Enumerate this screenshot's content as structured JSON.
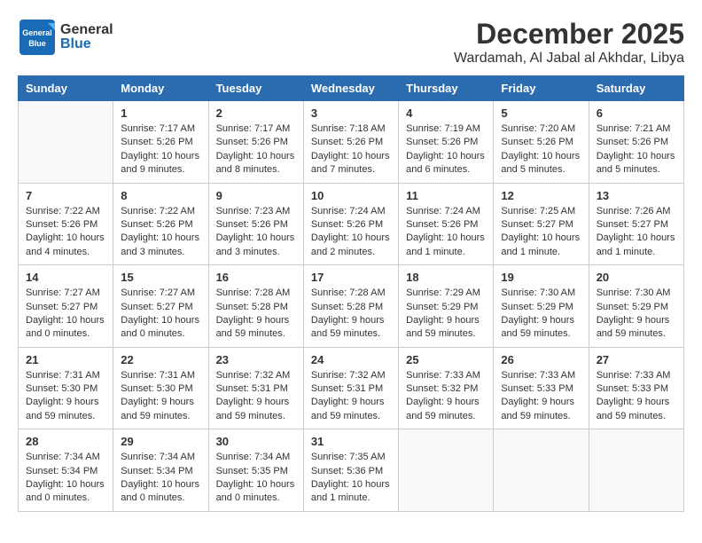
{
  "logo": {
    "general": "General",
    "blue": "Blue"
  },
  "title": "December 2025",
  "location": "Wardamah, Al Jabal al Akhdar, Libya",
  "days_of_week": [
    "Sunday",
    "Monday",
    "Tuesday",
    "Wednesday",
    "Thursday",
    "Friday",
    "Saturday"
  ],
  "weeks": [
    [
      {
        "day": "",
        "sunrise": "",
        "sunset": "",
        "daylight": "",
        "empty": true
      },
      {
        "day": "1",
        "sunrise": "Sunrise: 7:17 AM",
        "sunset": "Sunset: 5:26 PM",
        "daylight": "Daylight: 10 hours and 9 minutes."
      },
      {
        "day": "2",
        "sunrise": "Sunrise: 7:17 AM",
        "sunset": "Sunset: 5:26 PM",
        "daylight": "Daylight: 10 hours and 8 minutes."
      },
      {
        "day": "3",
        "sunrise": "Sunrise: 7:18 AM",
        "sunset": "Sunset: 5:26 PM",
        "daylight": "Daylight: 10 hours and 7 minutes."
      },
      {
        "day": "4",
        "sunrise": "Sunrise: 7:19 AM",
        "sunset": "Sunset: 5:26 PM",
        "daylight": "Daylight: 10 hours and 6 minutes."
      },
      {
        "day": "5",
        "sunrise": "Sunrise: 7:20 AM",
        "sunset": "Sunset: 5:26 PM",
        "daylight": "Daylight: 10 hours and 5 minutes."
      },
      {
        "day": "6",
        "sunrise": "Sunrise: 7:21 AM",
        "sunset": "Sunset: 5:26 PM",
        "daylight": "Daylight: 10 hours and 5 minutes."
      }
    ],
    [
      {
        "day": "7",
        "sunrise": "Sunrise: 7:22 AM",
        "sunset": "Sunset: 5:26 PM",
        "daylight": "Daylight: 10 hours and 4 minutes."
      },
      {
        "day": "8",
        "sunrise": "Sunrise: 7:22 AM",
        "sunset": "Sunset: 5:26 PM",
        "daylight": "Daylight: 10 hours and 3 minutes."
      },
      {
        "day": "9",
        "sunrise": "Sunrise: 7:23 AM",
        "sunset": "Sunset: 5:26 PM",
        "daylight": "Daylight: 10 hours and 3 minutes."
      },
      {
        "day": "10",
        "sunrise": "Sunrise: 7:24 AM",
        "sunset": "Sunset: 5:26 PM",
        "daylight": "Daylight: 10 hours and 2 minutes."
      },
      {
        "day": "11",
        "sunrise": "Sunrise: 7:24 AM",
        "sunset": "Sunset: 5:26 PM",
        "daylight": "Daylight: 10 hours and 1 minute."
      },
      {
        "day": "12",
        "sunrise": "Sunrise: 7:25 AM",
        "sunset": "Sunset: 5:27 PM",
        "daylight": "Daylight: 10 hours and 1 minute."
      },
      {
        "day": "13",
        "sunrise": "Sunrise: 7:26 AM",
        "sunset": "Sunset: 5:27 PM",
        "daylight": "Daylight: 10 hours and 1 minute."
      }
    ],
    [
      {
        "day": "14",
        "sunrise": "Sunrise: 7:27 AM",
        "sunset": "Sunset: 5:27 PM",
        "daylight": "Daylight: 10 hours and 0 minutes."
      },
      {
        "day": "15",
        "sunrise": "Sunrise: 7:27 AM",
        "sunset": "Sunset: 5:27 PM",
        "daylight": "Daylight: 10 hours and 0 minutes."
      },
      {
        "day": "16",
        "sunrise": "Sunrise: 7:28 AM",
        "sunset": "Sunset: 5:28 PM",
        "daylight": "Daylight: 9 hours and 59 minutes."
      },
      {
        "day": "17",
        "sunrise": "Sunrise: 7:28 AM",
        "sunset": "Sunset: 5:28 PM",
        "daylight": "Daylight: 9 hours and 59 minutes."
      },
      {
        "day": "18",
        "sunrise": "Sunrise: 7:29 AM",
        "sunset": "Sunset: 5:29 PM",
        "daylight": "Daylight: 9 hours and 59 minutes."
      },
      {
        "day": "19",
        "sunrise": "Sunrise: 7:30 AM",
        "sunset": "Sunset: 5:29 PM",
        "daylight": "Daylight: 9 hours and 59 minutes."
      },
      {
        "day": "20",
        "sunrise": "Sunrise: 7:30 AM",
        "sunset": "Sunset: 5:29 PM",
        "daylight": "Daylight: 9 hours and 59 minutes."
      }
    ],
    [
      {
        "day": "21",
        "sunrise": "Sunrise: 7:31 AM",
        "sunset": "Sunset: 5:30 PM",
        "daylight": "Daylight: 9 hours and 59 minutes."
      },
      {
        "day": "22",
        "sunrise": "Sunrise: 7:31 AM",
        "sunset": "Sunset: 5:30 PM",
        "daylight": "Daylight: 9 hours and 59 minutes."
      },
      {
        "day": "23",
        "sunrise": "Sunrise: 7:32 AM",
        "sunset": "Sunset: 5:31 PM",
        "daylight": "Daylight: 9 hours and 59 minutes."
      },
      {
        "day": "24",
        "sunrise": "Sunrise: 7:32 AM",
        "sunset": "Sunset: 5:31 PM",
        "daylight": "Daylight: 9 hours and 59 minutes."
      },
      {
        "day": "25",
        "sunrise": "Sunrise: 7:33 AM",
        "sunset": "Sunset: 5:32 PM",
        "daylight": "Daylight: 9 hours and 59 minutes."
      },
      {
        "day": "26",
        "sunrise": "Sunrise: 7:33 AM",
        "sunset": "Sunset: 5:33 PM",
        "daylight": "Daylight: 9 hours and 59 minutes."
      },
      {
        "day": "27",
        "sunrise": "Sunrise: 7:33 AM",
        "sunset": "Sunset: 5:33 PM",
        "daylight": "Daylight: 9 hours and 59 minutes."
      }
    ],
    [
      {
        "day": "28",
        "sunrise": "Sunrise: 7:34 AM",
        "sunset": "Sunset: 5:34 PM",
        "daylight": "Daylight: 10 hours and 0 minutes."
      },
      {
        "day": "29",
        "sunrise": "Sunrise: 7:34 AM",
        "sunset": "Sunset: 5:34 PM",
        "daylight": "Daylight: 10 hours and 0 minutes."
      },
      {
        "day": "30",
        "sunrise": "Sunrise: 7:34 AM",
        "sunset": "Sunset: 5:35 PM",
        "daylight": "Daylight: 10 hours and 0 minutes."
      },
      {
        "day": "31",
        "sunrise": "Sunrise: 7:35 AM",
        "sunset": "Sunset: 5:36 PM",
        "daylight": "Daylight: 10 hours and 1 minute."
      },
      {
        "day": "",
        "sunrise": "",
        "sunset": "",
        "daylight": "",
        "empty": true
      },
      {
        "day": "",
        "sunrise": "",
        "sunset": "",
        "daylight": "",
        "empty": true
      },
      {
        "day": "",
        "sunrise": "",
        "sunset": "",
        "daylight": "",
        "empty": true
      }
    ]
  ]
}
